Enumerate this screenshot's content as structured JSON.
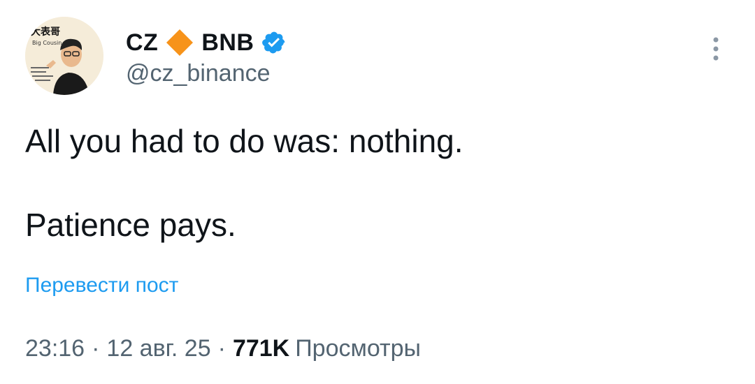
{
  "tweet": {
    "author": {
      "name_part1": "CZ",
      "name_emoji_icon": "orange-diamond-icon",
      "name_part2": "BNB",
      "verified_icon": "verified-badge-icon",
      "handle": "@cz_binance",
      "avatar_icon": "avatar-cartoon-icon",
      "avatar_text": "大表哥",
      "avatar_sub": "Big Cousin"
    },
    "more_icon": "more-vertical-icon",
    "lines": [
      "All you had to do was: nothing.",
      "Patience pays."
    ],
    "translate_label": "Перевести пост",
    "time": "23:16",
    "separator": "·",
    "date": "12 авг. 25",
    "views_count": "771K",
    "views_label": "Просмотры"
  },
  "colors": {
    "accent": "#1d9bf0",
    "diamond": "#f7931a",
    "text": "#0f1419",
    "secondary": "#536471"
  }
}
